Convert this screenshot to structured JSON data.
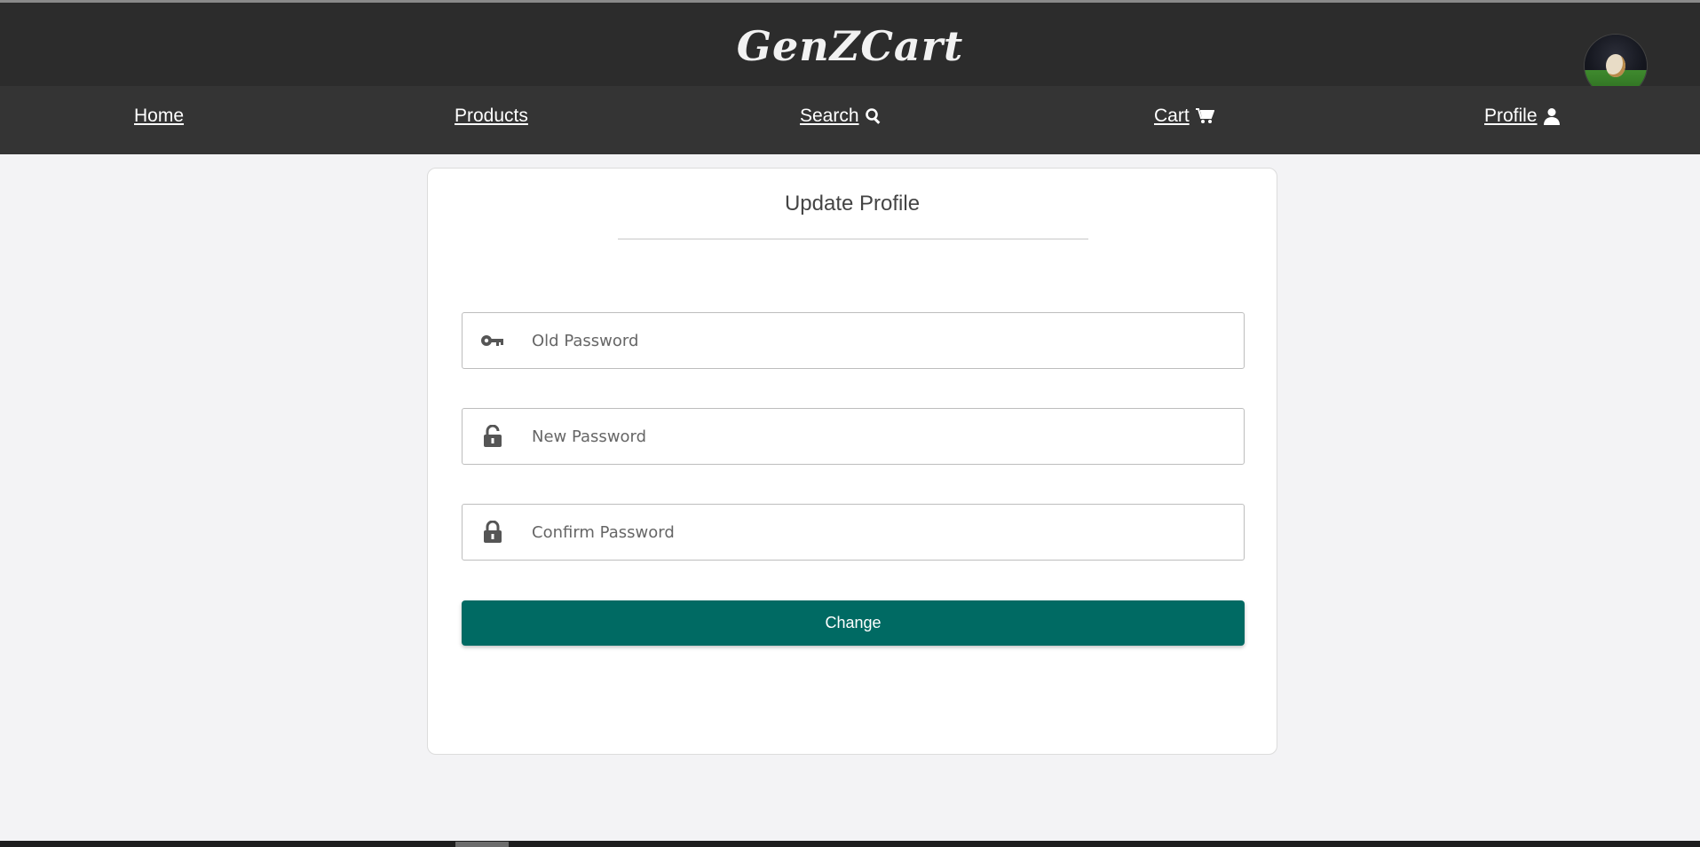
{
  "header": {
    "brand": "GenZCart"
  },
  "nav": {
    "items": [
      {
        "label": "Home",
        "icon": ""
      },
      {
        "label": "Products",
        "icon": ""
      },
      {
        "label": "Search ",
        "icon": "search-icon"
      },
      {
        "label": "Cart ",
        "icon": "cart-icon"
      },
      {
        "label": "Profile ",
        "icon": "user-icon"
      }
    ]
  },
  "form": {
    "title": "Update Profile",
    "old_password": {
      "placeholder": "Old Password",
      "value": "",
      "icon": "key-icon"
    },
    "new_password": {
      "placeholder": "New Password",
      "value": "",
      "icon": "unlock-icon"
    },
    "confirm_password": {
      "placeholder": "Confirm Password",
      "value": "",
      "icon": "lock-icon"
    },
    "submit_label": "Change"
  },
  "colors": {
    "header_bg": "#2c2c2c",
    "nav_bg": "#343434",
    "accent": "#006a63",
    "page_bg": "#f3f3f5"
  }
}
